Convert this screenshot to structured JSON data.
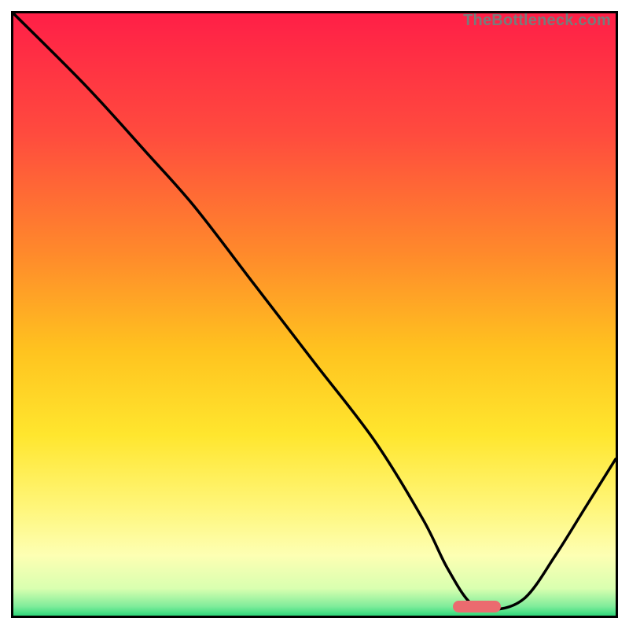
{
  "watermark": "TheBottleneck.com",
  "chart_data": {
    "type": "line",
    "title": "",
    "xlabel": "",
    "ylabel": "",
    "xlim": [
      0,
      100
    ],
    "ylim": [
      0,
      100
    ],
    "gradient_stops": [
      {
        "offset": 0,
        "color": "#ff1f47"
      },
      {
        "offset": 0.2,
        "color": "#ff4b3e"
      },
      {
        "offset": 0.4,
        "color": "#ff8a2b"
      },
      {
        "offset": 0.56,
        "color": "#ffc31f"
      },
      {
        "offset": 0.7,
        "color": "#ffe62e"
      },
      {
        "offset": 0.82,
        "color": "#fff67a"
      },
      {
        "offset": 0.9,
        "color": "#fdffb3"
      },
      {
        "offset": 0.955,
        "color": "#d9ffb0"
      },
      {
        "offset": 0.985,
        "color": "#7eec9a"
      },
      {
        "offset": 1.0,
        "color": "#2fd87a"
      }
    ],
    "series": [
      {
        "name": "bottleneck-curve",
        "x": [
          0,
          12,
          22,
          30,
          40,
          50,
          60,
          68,
          72,
          76,
          80,
          85,
          90,
          95,
          100
        ],
        "y": [
          100,
          88,
          77,
          68,
          55,
          42,
          29,
          16,
          8,
          2,
          1,
          3,
          10,
          18,
          26
        ]
      }
    ],
    "marker": {
      "x_start": 73,
      "x_end": 81,
      "y": 0,
      "color": "#eb6b6f"
    }
  }
}
